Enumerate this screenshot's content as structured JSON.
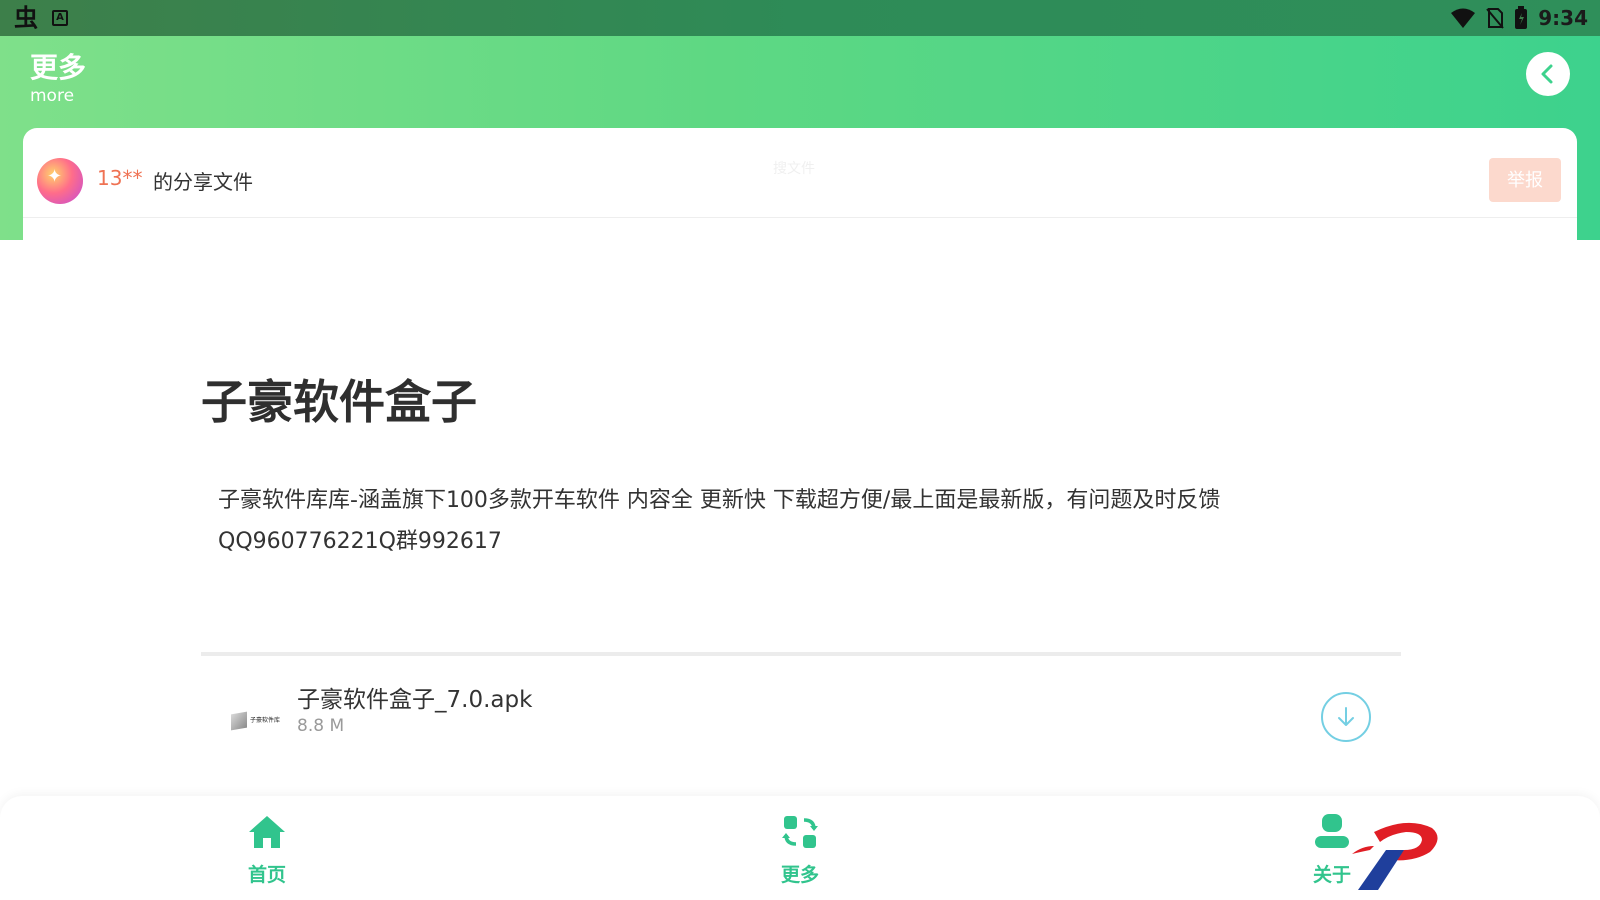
{
  "status_bar": {
    "left_icons": [
      "bug-icon",
      "a-icon"
    ],
    "time": "9:34",
    "right_icons": [
      "wifi-icon",
      "no-sim-icon",
      "battery-icon"
    ]
  },
  "header": {
    "title": "更多",
    "subtitle": "more",
    "back_icon": "chevron-left-icon",
    "gradient_colors": [
      "#7fe08a",
      "#3dd28d"
    ]
  },
  "share": {
    "username": "13**",
    "label": "的分享文件",
    "search_hint": "搜文件",
    "report_label": "举报"
  },
  "document": {
    "title": "子豪软件盒子",
    "description": "子豪软件库库-涵盖旗下100多款开车软件 内容全 更新快 下载超方便/最上面是最新版，有问题及时反馈QQ960776221Q群992617"
  },
  "file": {
    "name": "子豪软件盒子_7.0.apk",
    "size": "8.8 M",
    "thumb_text": "子豪软件库"
  },
  "bottom_nav": {
    "items": [
      {
        "label": "首页",
        "icon": "home-icon"
      },
      {
        "label": "更多",
        "icon": "more-icon"
      },
      {
        "label": "关于",
        "icon": "user-icon"
      }
    ],
    "accent_color": "#31c48d"
  },
  "colors": {
    "username": "#ef7253",
    "report_button": "#fcd9cd",
    "download_ring": "#74cfe3"
  }
}
